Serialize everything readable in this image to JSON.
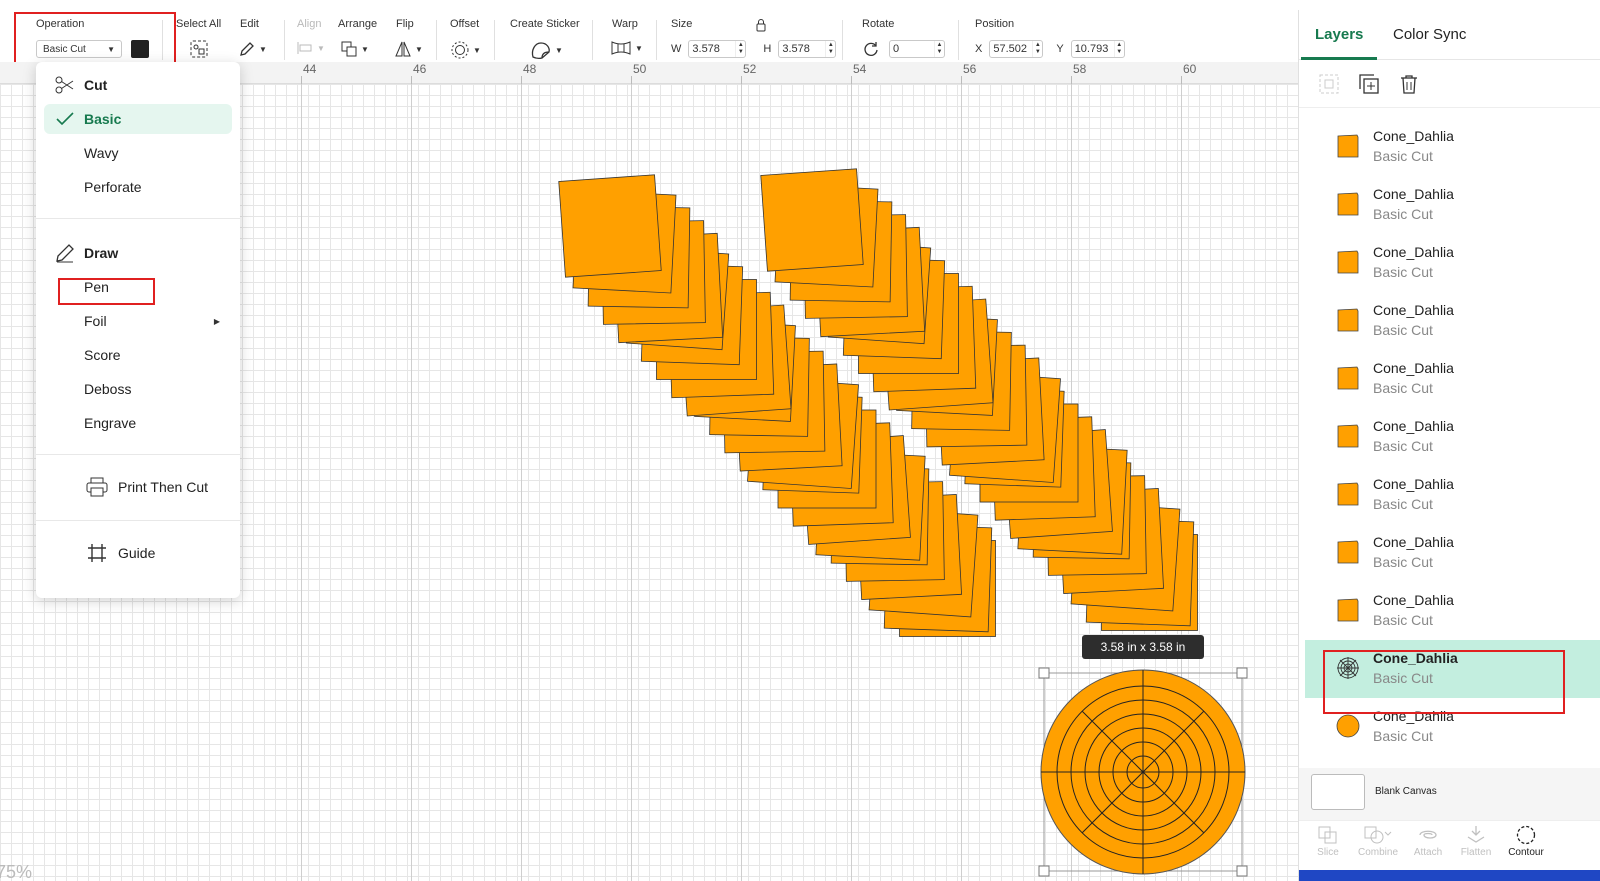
{
  "toolbar": {
    "operation_label": "Operation",
    "operation_value": "Basic Cut",
    "select_all_label": "Select All",
    "edit_label": "Edit",
    "align_label": "Align",
    "arrange_label": "Arrange",
    "flip_label": "Flip",
    "offset_label": "Offset",
    "create_sticker_label": "Create Sticker",
    "warp_label": "Warp",
    "size_label": "Size",
    "size_w_letter": "W",
    "size_w_value": "3.578",
    "size_h_letter": "H",
    "size_h_value": "3.578",
    "rotate_label": "Rotate",
    "rotate_value": "0",
    "position_label": "Position",
    "pos_x_letter": "X",
    "pos_x_value": "57.502",
    "pos_y_letter": "Y",
    "pos_y_value": "10.793"
  },
  "ruler": {
    "ticks": [
      "44",
      "46",
      "48",
      "50",
      "52",
      "54",
      "56",
      "58",
      "60"
    ]
  },
  "canvas": {
    "zoom_label": "75%",
    "tooltip": "3.58  in x 3.58  in",
    "shape_color": "#FFA000"
  },
  "operation_menu": {
    "cut_header": "Cut",
    "cut_items": [
      "Basic",
      "Wavy",
      "Perforate"
    ],
    "selected": "Basic",
    "draw_header": "Draw",
    "draw_items": [
      "Pen",
      "Foil",
      "Score",
      "Deboss",
      "Engrave"
    ],
    "print_then_cut": "Print Then Cut",
    "guide": "Guide"
  },
  "panel": {
    "tabs": [
      "Layers",
      "Color Sync"
    ],
    "active_tab": "Layers",
    "layers": [
      {
        "name": "Cone_Dahlia",
        "type": "Basic Cut",
        "thumb": "square"
      },
      {
        "name": "Cone_Dahlia",
        "type": "Basic Cut",
        "thumb": "square"
      },
      {
        "name": "Cone_Dahlia",
        "type": "Basic Cut",
        "thumb": "square"
      },
      {
        "name": "Cone_Dahlia",
        "type": "Basic Cut",
        "thumb": "square"
      },
      {
        "name": "Cone_Dahlia",
        "type": "Basic Cut",
        "thumb": "square"
      },
      {
        "name": "Cone_Dahlia",
        "type": "Basic Cut",
        "thumb": "square"
      },
      {
        "name": "Cone_Dahlia",
        "type": "Basic Cut",
        "thumb": "square"
      },
      {
        "name": "Cone_Dahlia",
        "type": "Basic Cut",
        "thumb": "square"
      },
      {
        "name": "Cone_Dahlia",
        "type": "Basic Cut",
        "thumb": "square"
      },
      {
        "name": "Cone_Dahlia",
        "type": "Basic Cut",
        "thumb": "web",
        "selected": true
      },
      {
        "name": "Cone_Dahlia",
        "type": "Basic Cut",
        "thumb": "circle"
      }
    ],
    "blank_canvas_label": "Blank Canvas",
    "bottom_tools": [
      "Slice",
      "Combine",
      "Attach",
      "Flatten",
      "Contour"
    ],
    "accent_color": "#177A4F",
    "selected_color": "#C3EEDF"
  }
}
